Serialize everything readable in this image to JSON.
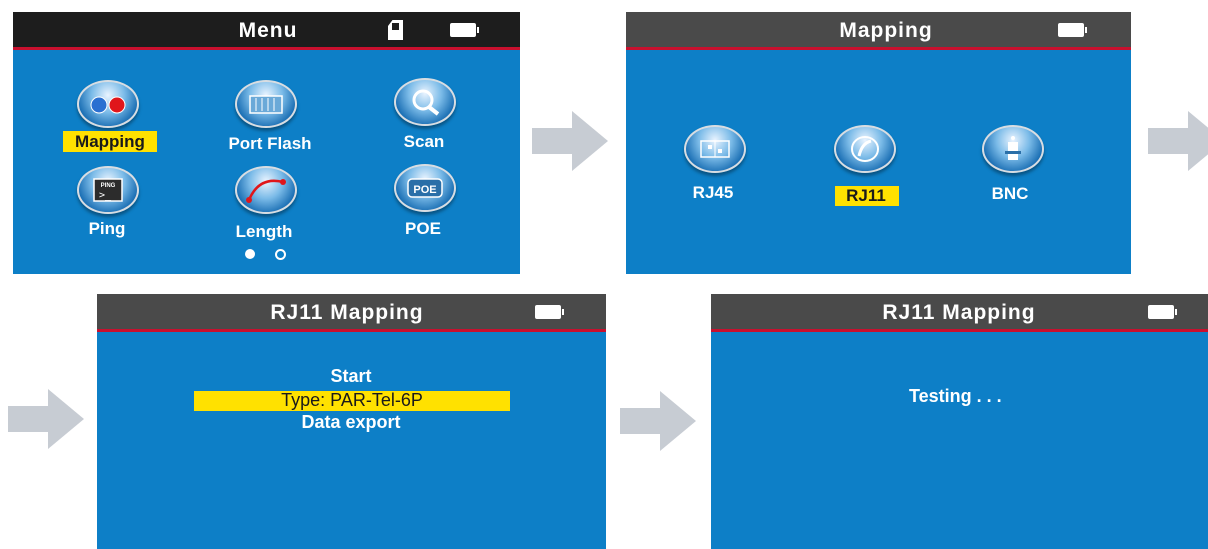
{
  "screens": {
    "menu": {
      "title": "Menu",
      "items": [
        {
          "label": "Mapping",
          "icon": "mapping-icon",
          "highlighted": true
        },
        {
          "label": "Port Flash",
          "icon": "port-flash-icon",
          "highlighted": false
        },
        {
          "label": "Scan",
          "icon": "scan-icon",
          "highlighted": false
        },
        {
          "label": "Ping",
          "icon": "ping-icon",
          "highlighted": false
        },
        {
          "label": "Length",
          "icon": "length-icon",
          "highlighted": false
        },
        {
          "label": "POE",
          "icon": "poe-icon",
          "highlighted": false
        }
      ],
      "page_indicator": {
        "current": 1,
        "total": 2
      },
      "ping_icon_text": "PING",
      "poe_icon_text": "POE"
    },
    "mapping": {
      "title": "Mapping",
      "items": [
        {
          "label": "RJ45",
          "icon": "rj45-icon",
          "highlighted": false
        },
        {
          "label": "RJ11",
          "icon": "rj11-icon",
          "highlighted": true
        },
        {
          "label": "BNC",
          "icon": "bnc-icon",
          "highlighted": false
        }
      ]
    },
    "rj11_options": {
      "title": "RJ11  Mapping",
      "options": [
        {
          "label": "Start",
          "highlighted": false
        },
        {
          "label": "Type: PAR-Tel-6P",
          "highlighted": true
        },
        {
          "label": "Data export",
          "highlighted": false
        }
      ]
    },
    "rj11_testing": {
      "title": "RJ11  Mapping",
      "status": "Testing . . ."
    }
  },
  "colors": {
    "screen_bg": "#0d7fc7",
    "title_bar": "#4a4a4a",
    "title_bar_menu": "#1d1d1d",
    "title_border": "#c8102e",
    "highlight": "#ffe100",
    "arrow": "#c7ccd3"
  }
}
